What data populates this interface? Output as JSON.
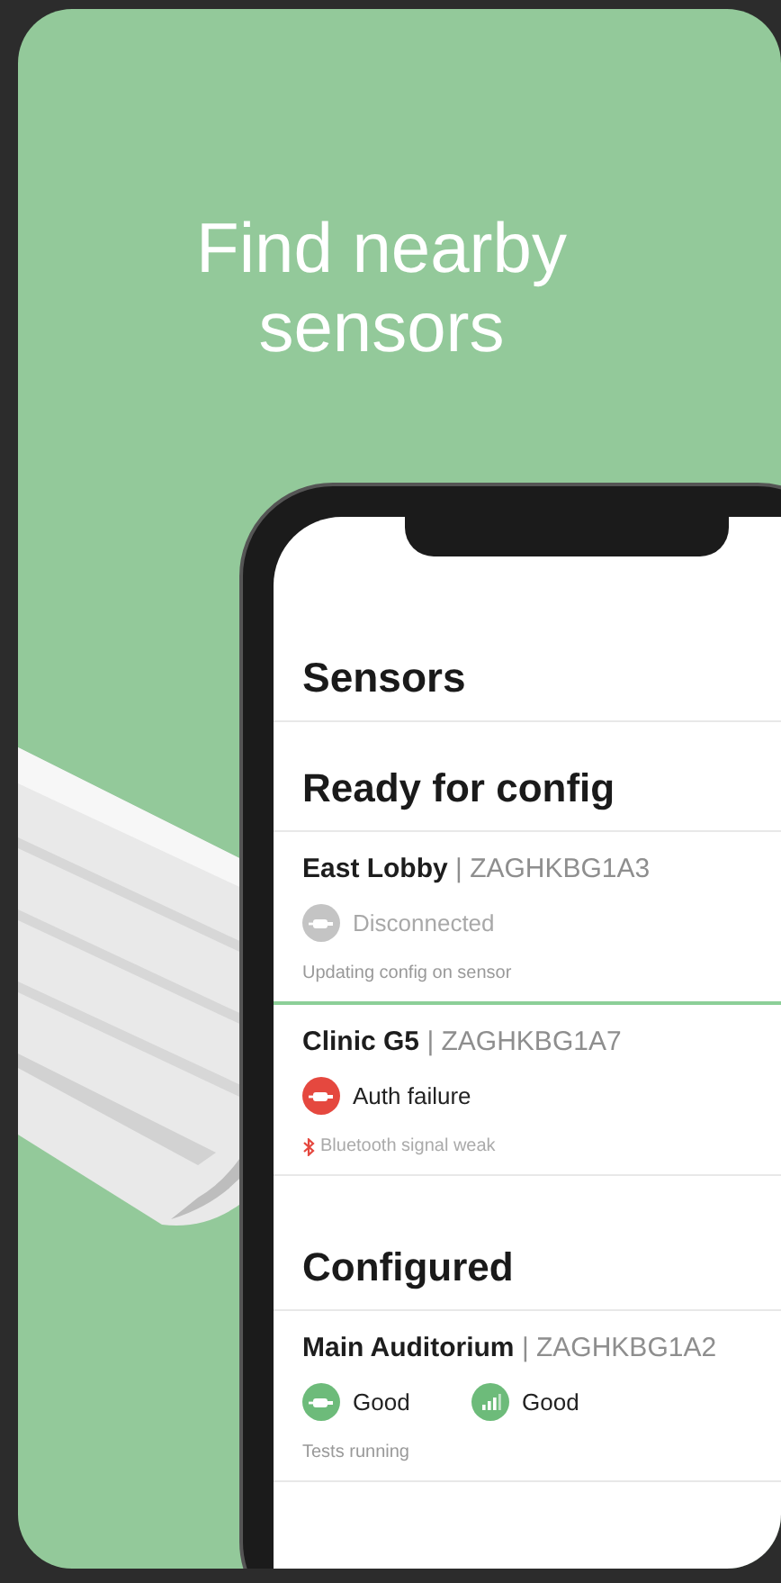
{
  "headline": "Find nearby sensors",
  "screen": {
    "title": "Sensors",
    "sections": [
      {
        "title": "Ready for config",
        "sensors": [
          {
            "label": "**East Lobby** | ZAGHKBG1A3",
            "statuses": [
              {
                "kind": "plug",
                "label": "Disconnected",
                "color": "#c4c4c4",
                "muted": true
              }
            ],
            "note": {
              "kind": "plain",
              "text": "Updating config on sensor"
            },
            "progress": true
          },
          {
            "label": "**Clinic G5** | ZAGHKBG1A7",
            "statuses": [
              {
                "kind": "plug",
                "label": "Auth failure",
                "color": "#e5483f",
                "muted": false
              }
            ],
            "note": {
              "kind": "bluetooth",
              "text": "Bluetooth signal weak"
            },
            "progress": false
          }
        ]
      },
      {
        "title": "Configured",
        "sensors": [
          {
            "label": "**Main Auditorium** | ZAGHKBG1A2",
            "statuses": [
              {
                "kind": "plug",
                "label": "Good",
                "color": "#6dbb7a",
                "muted": false
              },
              {
                "kind": "signal",
                "label": "Good",
                "color": "#6dbb7a",
                "muted": false
              }
            ],
            "note": {
              "kind": "plain",
              "text": "Tests running"
            },
            "progress": false
          }
        ]
      }
    ]
  }
}
